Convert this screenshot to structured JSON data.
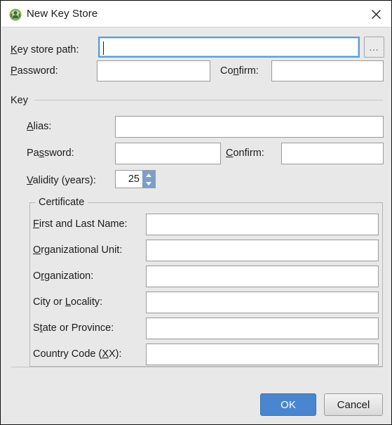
{
  "window": {
    "title": "New Key Store",
    "icon": "keystore-app-icon",
    "close_icon": "close-icon"
  },
  "keystore": {
    "path_label_pre": "",
    "path_label_accel": "K",
    "path_label_post": "ey store path:",
    "path_value": "",
    "browse_label": "...",
    "password_label_accel": "P",
    "password_label_post": "assword:",
    "password_value": "",
    "confirm_label_pre": "Co",
    "confirm_label_accel": "n",
    "confirm_label_post": "firm:",
    "confirm_value": ""
  },
  "key_section": {
    "title": "Key",
    "alias_label_accel": "A",
    "alias_label_post": "lias:",
    "alias_value": "",
    "password_label_pre": "Pa",
    "password_label_accel": "s",
    "password_label_post": "sword:",
    "password_value": "",
    "confirm_label_accel": "C",
    "confirm_label_post": "onfirm:",
    "confirm_value": "",
    "validity_label_accel": "V",
    "validity_label_post": "alidity (years):",
    "validity_value": "25"
  },
  "certificate": {
    "legend": "Certificate",
    "fields": [
      {
        "name": "first-and-last-name",
        "label_pre": "",
        "label_accel": "F",
        "label_post": "irst and Last Name:",
        "value": ""
      },
      {
        "name": "organizational-unit",
        "label_pre": "",
        "label_accel": "O",
        "label_post": "rganizational Unit:",
        "value": ""
      },
      {
        "name": "organization",
        "label_pre": "O",
        "label_accel": "r",
        "label_post": "ganization:",
        "value": ""
      },
      {
        "name": "city-or-locality",
        "label_pre": "City or ",
        "label_accel": "L",
        "label_post": "ocality:",
        "value": ""
      },
      {
        "name": "state-or-province",
        "label_pre": "S",
        "label_accel": "t",
        "label_post": "ate or Province:",
        "value": ""
      },
      {
        "name": "country-code",
        "label_pre": "Country Code (",
        "label_accel": "X",
        "label_post": "X):",
        "value": ""
      }
    ]
  },
  "footer": {
    "ok_label": "OK",
    "cancel_label": "Cancel"
  },
  "colors": {
    "dialog_bg": "#e8e8e8",
    "titlebar_bg": "#ffffff",
    "field_bg": "#ffffff",
    "field_border": "#9a9a9a",
    "focus_border": "#5a9fd4",
    "primary_button": "#4a86d0",
    "spinner_button": "#7a9fcc",
    "icon_green": "#7cba3d"
  }
}
